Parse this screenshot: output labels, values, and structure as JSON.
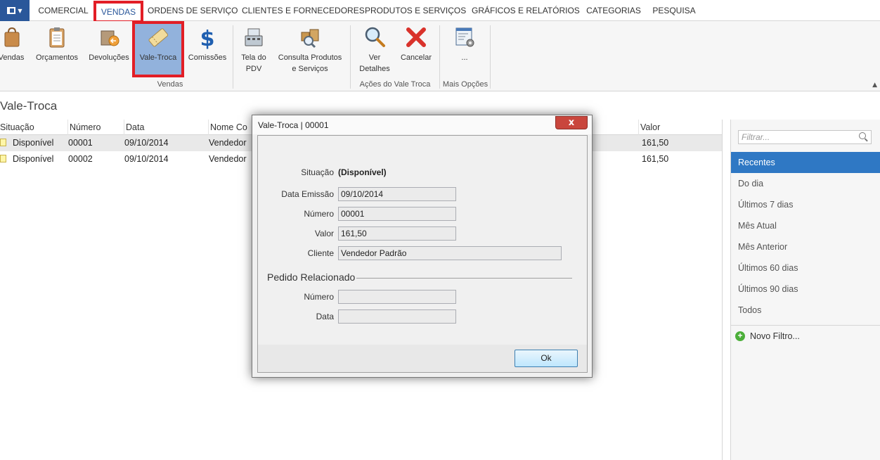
{
  "menu": {
    "tabs": [
      "COMERCIAL",
      "VENDAS",
      "ORDENS DE SERVIÇO",
      "CLIENTES E FORNECEDORES",
      "PRODUTOS E SERVIÇOS",
      "GRÁFICOS E RELATÓRIOS",
      "CATEGORIAS",
      "PESQUISA"
    ],
    "active_tab": "VENDAS"
  },
  "ribbon": {
    "vendas": "Vendas",
    "orcamentos": "Orçamentos",
    "devolucoes": "Devoluções",
    "vale_troca": "Vale-Troca",
    "comissoes": "Comissões",
    "tela_pdv_1": "Tela do",
    "tela_pdv_2": "PDV",
    "consulta_1": "Consulta Produtos",
    "consulta_2": "e Serviços",
    "ver_1": "Ver",
    "ver_2": "Detalhes",
    "cancelar": "Cancelar",
    "mais": "...",
    "group_vendas": "Vendas",
    "group_acoes": "Ações do Vale Troca",
    "group_mais": "Mais Opções"
  },
  "page": {
    "title": "Vale-Troca"
  },
  "grid": {
    "headers": {
      "situacao": "Situação",
      "numero": "Número",
      "data": "Data",
      "nome": "Nome Co",
      "valor": "Valor"
    },
    "rows": [
      {
        "situacao": "Disponível",
        "numero": "00001",
        "data": "09/10/2014",
        "nome": "Vendedor",
        "valor": "161,50"
      },
      {
        "situacao": "Disponível",
        "numero": "00002",
        "data": "09/10/2014",
        "nome": "Vendedor",
        "valor": "161,50"
      }
    ]
  },
  "filters": {
    "placeholder": "Filtrar...",
    "items": [
      "Recentes",
      "Do dia",
      "Últimos 7 dias",
      "Mês Atual",
      "Mês Anterior",
      "Últimos 60 dias",
      "Últimos 90 dias",
      "Todos"
    ],
    "active": "Recentes",
    "new_filter": "Novo Filtro..."
  },
  "modal": {
    "title": "Vale-Troca | 00001",
    "close": "x",
    "situacao_label": "Situação",
    "situacao_value": "(Disponível)",
    "data_emissao_label": "Data Emissão",
    "data_emissao": "09/10/2014",
    "numero_label": "Número",
    "numero": "00001",
    "valor_label": "Valor",
    "valor": "161,50",
    "cliente_label": "Cliente",
    "cliente": "Vendedor Padrão",
    "pedido_section": "Pedido Relacionado",
    "pedido_numero_label": "Número",
    "pedido_numero": "",
    "pedido_data_label": "Data",
    "pedido_data": "",
    "ok": "Ok"
  },
  "colors": {
    "accent": "#2a579a",
    "highlight": "#e21e26",
    "selected_filter": "#2f78c4",
    "selected_ribbon": "#92b2dc"
  }
}
